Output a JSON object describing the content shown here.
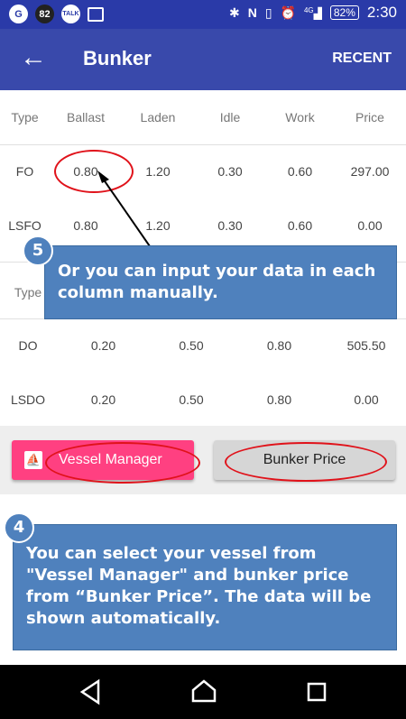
{
  "status_bar": {
    "notif_1": "G",
    "notif_2": "82",
    "notif_3": "TALK",
    "network": "4G",
    "battery": "82%",
    "time": "2:30"
  },
  "app_bar": {
    "back_icon": "arrow-left-icon",
    "title": "Bunker",
    "action": "RECENT"
  },
  "table1": {
    "headers": [
      "Type",
      "Ballast",
      "Laden",
      "Idle",
      "Work",
      "Price"
    ],
    "rows": [
      [
        "FO",
        "0.80",
        "1.20",
        "0.30",
        "0.60",
        "297.00"
      ],
      [
        "LSFO",
        "0.80",
        "1.20",
        "0.30",
        "0.60",
        "0.00"
      ]
    ]
  },
  "table2": {
    "headers": [
      "Type"
    ],
    "rows": [
      [
        "DO",
        "0.20",
        "0.50",
        "0.80",
        "505.50"
      ],
      [
        "LSDO",
        "0.20",
        "0.50",
        "0.80",
        "0.00"
      ]
    ]
  },
  "buttons": {
    "vessel_manager": "Vessel Manager",
    "bunker_price": "Bunker Price"
  },
  "callouts": {
    "step5_number": "5",
    "step5_text": "Or you can input your data in each column manually.",
    "step4_number": "4",
    "step4_text": "You can select your vessel from \"Vessel Manager\" and bunker price from “Bunker Price”. The data will be shown automatically."
  },
  "colors": {
    "app_bar": "#3949ab",
    "status_bar": "#2a3aa8",
    "accent": "#ff4081",
    "callout": "#4f81bd",
    "highlight": "#e0121a"
  }
}
